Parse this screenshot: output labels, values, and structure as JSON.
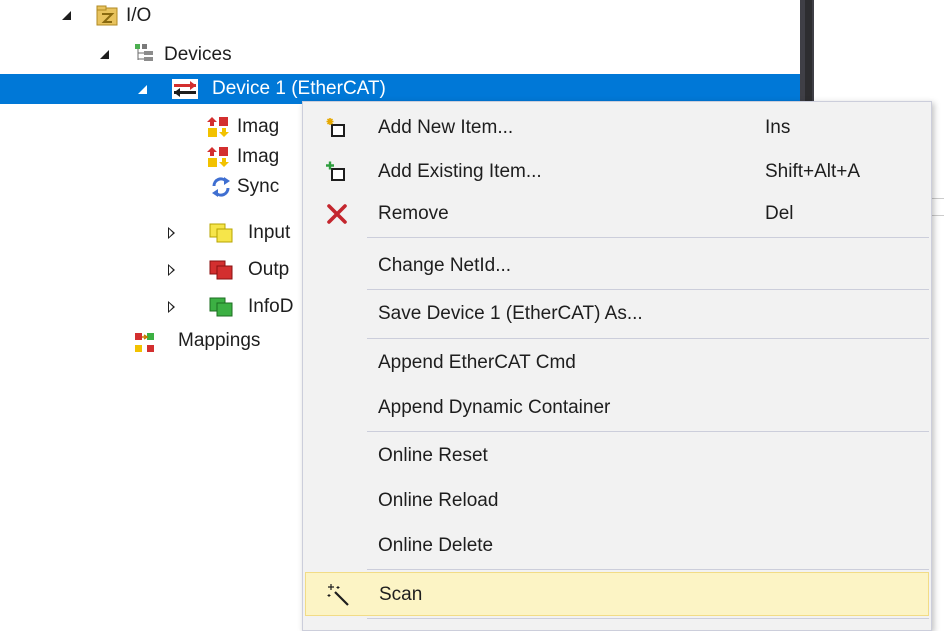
{
  "tree": {
    "io_label": "I/O",
    "devices_label": "Devices",
    "device1_label": "Device 1 (EtherCAT)",
    "image1_label": "Imag",
    "image2_label": "Imag",
    "sync_label": "Sync",
    "inputs_label": "Input",
    "outputs_label": "Outp",
    "infodata_label": "InfoD",
    "mappings_label": "Mappings"
  },
  "context_menu": {
    "add_new_item": {
      "label": "Add New Item...",
      "shortcut": "Ins"
    },
    "add_existing_item": {
      "label": "Add Existing Item...",
      "shortcut": "Shift+Alt+A"
    },
    "remove": {
      "label": "Remove",
      "shortcut": "Del"
    },
    "change_netid": {
      "label": "Change NetId..."
    },
    "save_device_as": {
      "label": "Save Device 1 (EtherCAT) As..."
    },
    "append_ethercat_cmd": {
      "label": "Append EtherCAT Cmd"
    },
    "append_dynamic_container": {
      "label": "Append Dynamic Container"
    },
    "online_reset": {
      "label": "Online Reset"
    },
    "online_reload": {
      "label": "Online Reload"
    },
    "online_delete": {
      "label": "Online Delete"
    },
    "scan": {
      "label": "Scan"
    }
  },
  "colors": {
    "selection": "#0078d7",
    "menu_background": "#f2f2f2",
    "menu_highlight": "#fcf4c5",
    "remove_icon": "#c4262e"
  },
  "icons": {
    "io": "io-folder-icon",
    "devices": "devices-icon",
    "device1": "ethercat-device-icon",
    "image": "process-image-icon",
    "sync": "sync-units-icon",
    "inputs": "inputs-folder-icon",
    "outputs": "outputs-folder-icon",
    "infodata": "infodata-folder-icon",
    "mappings": "mappings-icon",
    "add_new": "add-new-item-icon",
    "add_existing": "add-existing-item-icon",
    "remove": "remove-icon",
    "scan": "magic-wand-icon"
  }
}
